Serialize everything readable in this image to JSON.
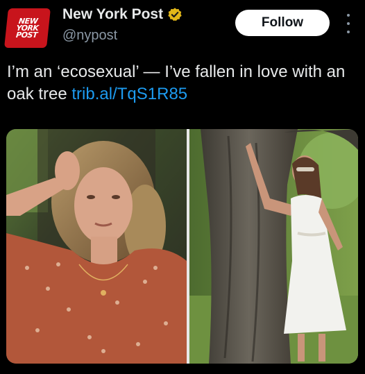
{
  "account": {
    "avatar_text": [
      "NEW",
      "YORK",
      "POST"
    ],
    "name": "New York Post",
    "handle": "@nypost",
    "verified": true
  },
  "actions": {
    "follow_label": "Follow",
    "more_icon": "more-vertical-icon"
  },
  "tweet": {
    "text": "I’m an ‘ecosexual’ — I’ve fallen in love with an oak tree ",
    "link": "trib.al/TqS1R85"
  },
  "media": {
    "images": [
      "woman with curly hair in floral top posing against tree",
      "woman in white dress leaning on large oak tree"
    ]
  },
  "colors": {
    "background": "#000000",
    "link": "#1d9bf0",
    "brand_red": "#c8141c",
    "verified_gold": "#e2b719"
  }
}
